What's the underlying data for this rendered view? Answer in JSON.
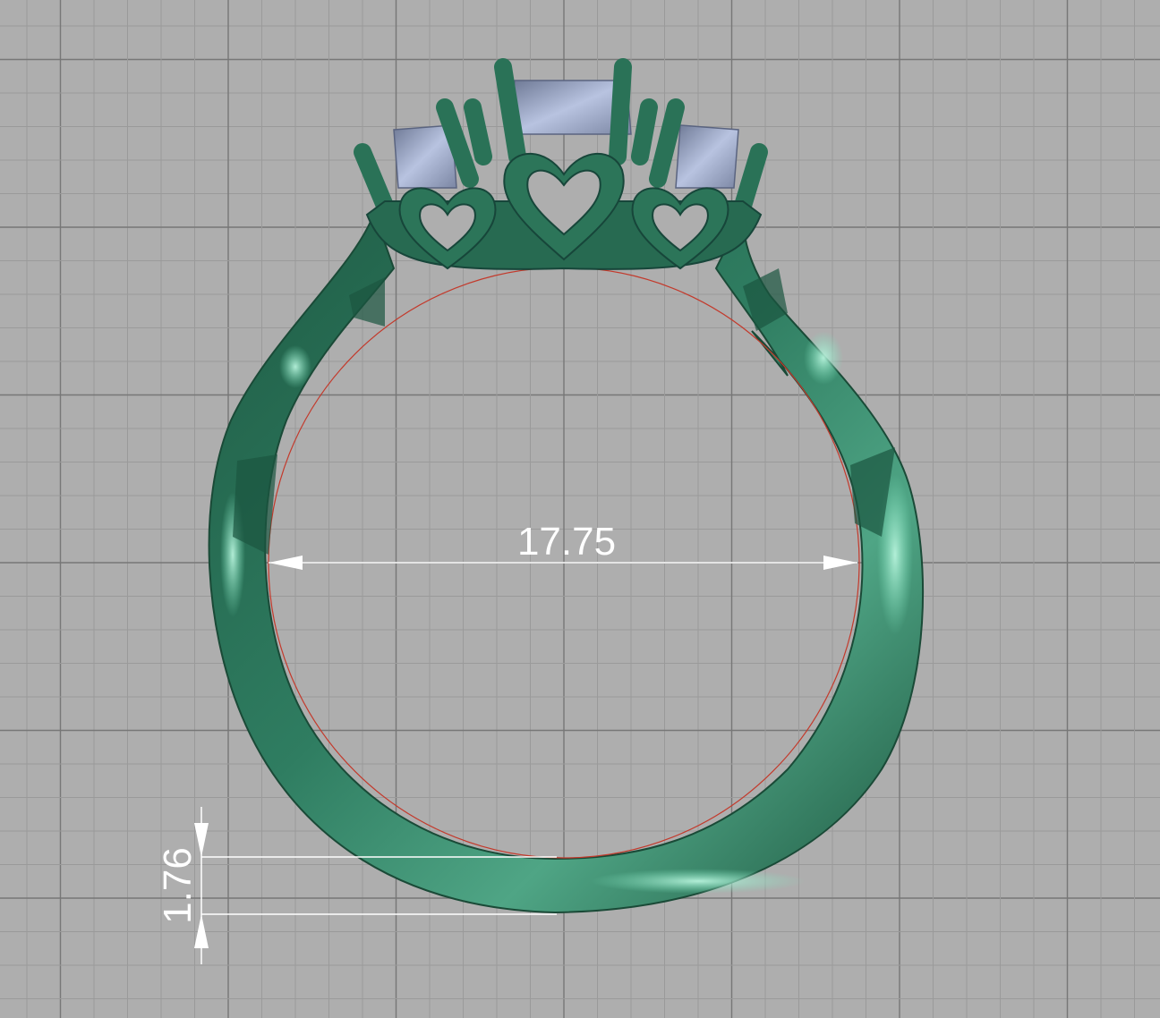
{
  "viewport": {
    "background_color": "#aeaeae",
    "grid_minor_color": "#9a9a9a",
    "grid_major_color": "#777777",
    "model_color": "#2f7d61",
    "model_highlight_color": "#7ce3bd",
    "model_shadow_color": "#174a37",
    "gem_color": "#a9b4d2",
    "inner_circle_color": "#c33a2c",
    "dimension_color": "#ffffff"
  },
  "dimensions": {
    "inner_diameter": {
      "value": "17.75"
    },
    "band_thickness": {
      "value": "1.76"
    }
  }
}
